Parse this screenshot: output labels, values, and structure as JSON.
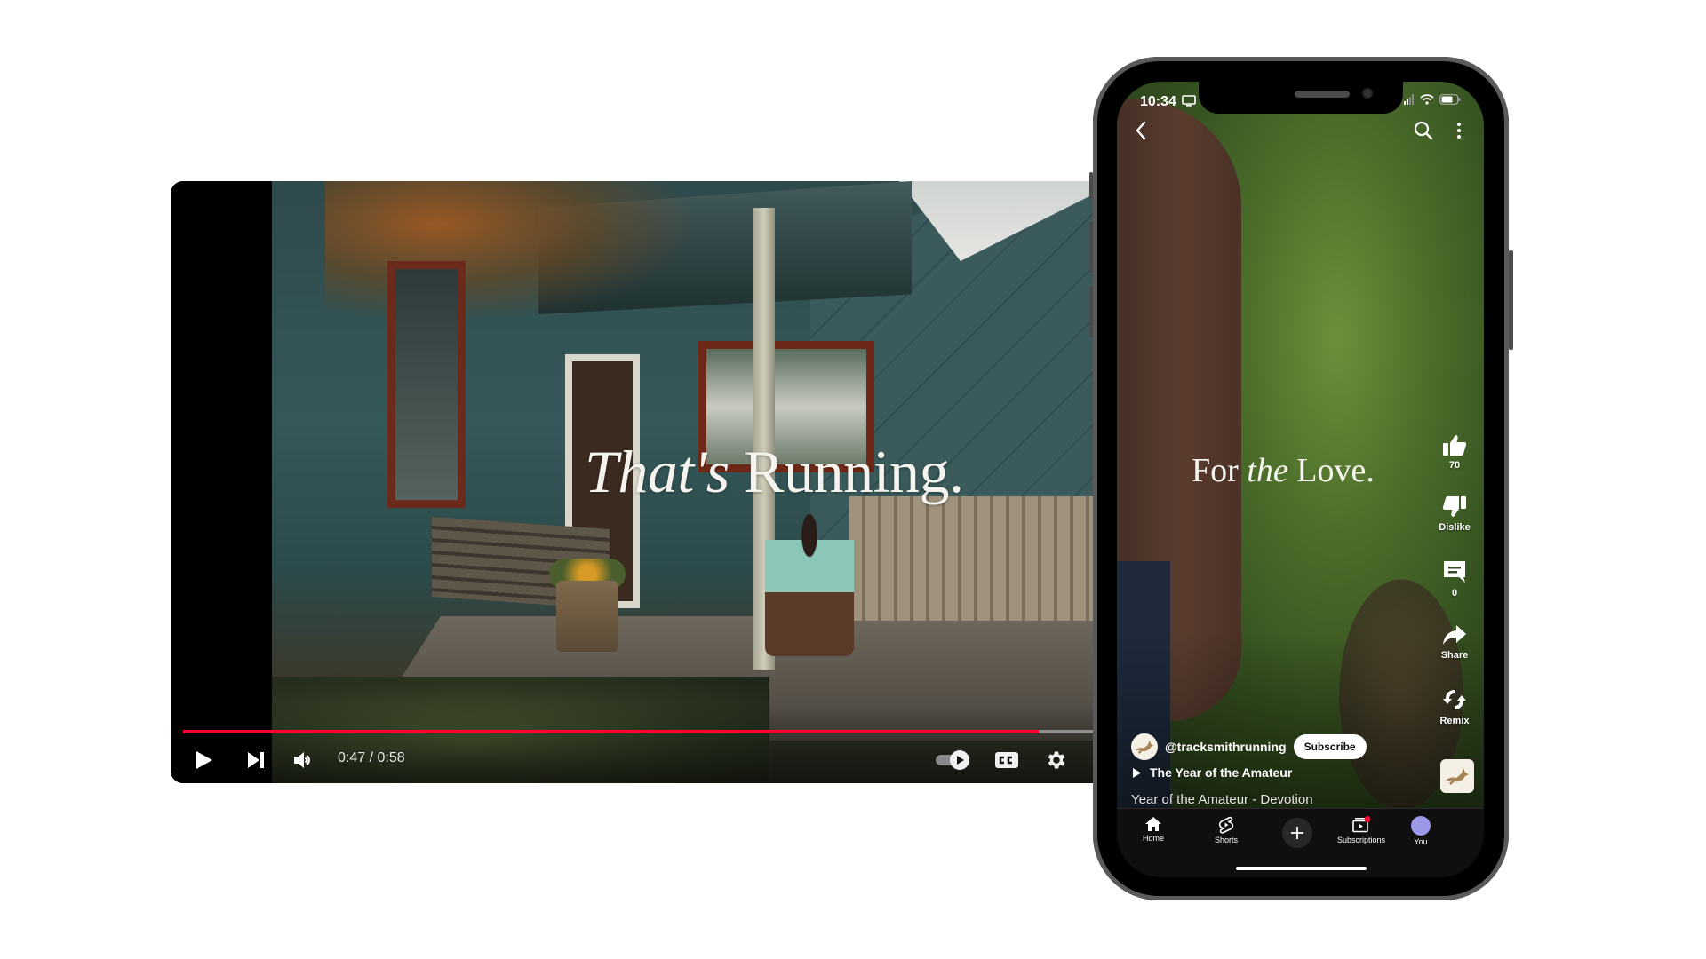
{
  "desktop_player": {
    "headline_italic": "That's",
    "headline_regular": "Running.",
    "current_time": "0:47",
    "duration": "0:58",
    "time_display": "0:47 / 0:58",
    "progress_played_fraction": 0.94,
    "controls": {
      "play": "play-icon",
      "next": "skip-next-icon",
      "volume": "volume-icon",
      "autoplay": "autoplay-toggle-icon",
      "captions": "cc-icon",
      "settings": "gear-icon"
    },
    "colors": {
      "progress": "#ff0033",
      "progress_track": "#c8c8c8"
    }
  },
  "phone": {
    "status_bar": {
      "time": "10:34"
    },
    "top_bar": {
      "back": "back-icon",
      "search": "search-icon",
      "more": "more-vert-icon"
    },
    "tagline_regular_1": "For",
    "tagline_italic": "the",
    "tagline_regular_2": "Love.",
    "actions": [
      {
        "icon": "like-icon",
        "label": "70"
      },
      {
        "icon": "dislike-icon",
        "label": "Dislike"
      },
      {
        "icon": "comment-icon",
        "label": "0"
      },
      {
        "icon": "share-icon",
        "label": "Share"
      },
      {
        "icon": "remix-icon",
        "label": "Remix"
      }
    ],
    "channel": {
      "handle": "@tracksmithrunning",
      "subscribe_label": "Subscribe"
    },
    "playlist": "The Year of the Amateur",
    "caption": "Year of the Amateur - Devotion",
    "nav": [
      {
        "icon": "home-icon",
        "label": "Home"
      },
      {
        "icon": "shorts-icon",
        "label": "Shorts"
      },
      {
        "icon": "create-icon",
        "label": ""
      },
      {
        "icon": "subscriptions-icon",
        "label": "Subscriptions"
      },
      {
        "icon": "avatar",
        "label": "You"
      }
    ],
    "colors": {
      "avatar": "#9b98e8",
      "notification_dot": "#ff0033"
    }
  }
}
